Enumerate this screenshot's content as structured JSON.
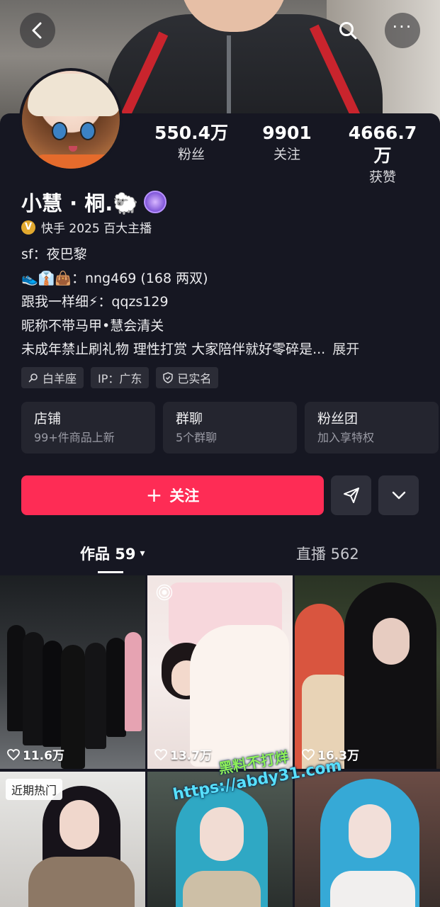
{
  "header": {
    "back_icon": "chevron-left-icon",
    "search_icon": "search-icon",
    "more_icon": "more-dots-icon",
    "more_label": "···"
  },
  "stats": [
    {
      "num": "550.4万",
      "label": "粉丝"
    },
    {
      "num": "9901",
      "label": "关注"
    },
    {
      "num": "4666.7万",
      "label": "获赞"
    }
  ],
  "profile": {
    "name": "小慧 · 桐.🐑",
    "verify_mark": "V",
    "verify_text": "快手 2025 百大主播",
    "bio": [
      "sf：夜巴黎",
      "👟👔👜：nng469 (168 两双)",
      "跟我一样细⚡：qqzs129",
      "昵称不带马甲•慧会清关",
      "未成年禁止刷礼物 理性打赏 大家陪伴就好零碎是..."
    ],
    "bio_more": "展开",
    "tags": [
      "白羊座",
      "IP：广东",
      "已实名"
    ]
  },
  "tiles": [
    {
      "title": "店铺",
      "sub": "99+件商品上新"
    },
    {
      "title": "群聊",
      "sub": "5个群聊"
    },
    {
      "title": "粉丝团",
      "sub": "加入享特权"
    }
  ],
  "actions": {
    "follow_plus": "+",
    "follow_label": "关注"
  },
  "tabs": {
    "works": "作品 59",
    "works_caret": "▾",
    "live": "直播 562"
  },
  "videos": [
    {
      "likes": "11.6万"
    },
    {
      "likes": "13.7万"
    },
    {
      "likes": "16.3万"
    },
    {
      "badge": "近期热门"
    },
    {},
    {}
  ],
  "watermark": {
    "line1": "黑料不打烊",
    "line2": "https://abdy31.com"
  },
  "colors": {
    "background": "#161722",
    "follow_button": "#fe2c55",
    "tile": "#24252f"
  }
}
